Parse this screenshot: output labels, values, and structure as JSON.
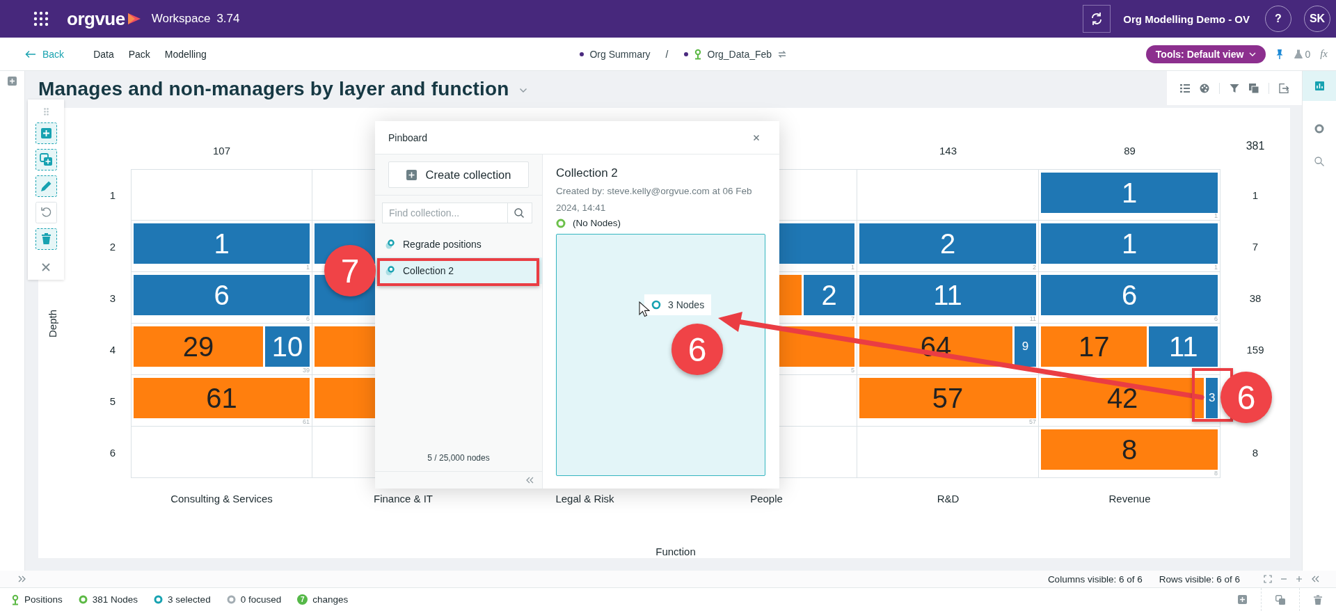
{
  "app_bar": {
    "logo": "orgvue",
    "product": "Workspace",
    "version": "3.74",
    "workspace_name": "Org Modelling Demo - OV",
    "help": "?",
    "user_initials": "SK"
  },
  "nav": {
    "back": "Back",
    "menu": [
      "Data",
      "Pack",
      "Modelling"
    ],
    "breadcrumb": [
      "Org Summary",
      "Org_Data_Feb"
    ],
    "separator": "/",
    "tools": "Tools: Default view",
    "flask_count": "0",
    "formula": "fx"
  },
  "chart": {
    "title": "Manages and non-managers by layer and function",
    "ylabel": "Depth",
    "xlabel": "Function",
    "grand_total": "381",
    "rows": [
      {
        "label": "1",
        "total": "1"
      },
      {
        "label": "2",
        "total": "7"
      },
      {
        "label": "3",
        "total": "38"
      },
      {
        "label": "4",
        "total": "159"
      },
      {
        "label": "5"
      },
      {
        "label": "6",
        "total": "8"
      }
    ],
    "columns": [
      {
        "label": "Consulting & Services",
        "total": "107",
        "cells": [
          {},
          {
            "segments": [
              {
                "color": "#1f77b4",
                "value": "1"
              }
            ],
            "count": "1"
          },
          {
            "segments": [
              {
                "color": "#1f77b4",
                "value": "6"
              }
            ],
            "count": "6"
          },
          {
            "segments": [
              {
                "color": "#ff7f0e",
                "value": "29"
              },
              {
                "color": "#1f77b4",
                "value": "10"
              }
            ],
            "count": "39"
          },
          {
            "segments": [
              {
                "color": "#ff7f0e",
                "value": "61"
              }
            ],
            "count": "61"
          },
          {}
        ]
      },
      {
        "label": "Finance & IT",
        "cells": [
          {},
          {
            "segments": [
              {
                "color": "#1f77b4"
              }
            ]
          },
          {
            "segments": [
              {
                "color": "#1f77b4"
              }
            ]
          },
          {
            "segments": [
              {
                "color": "#ff7f0e"
              }
            ]
          },
          {
            "segments": [
              {
                "color": "#ff7f0e"
              }
            ]
          },
          {}
        ]
      },
      {
        "label": "Legal & Risk"
      },
      {
        "label": "People",
        "cells": [
          {},
          {
            "segments": [
              {
                "color": "#1f77b4"
              }
            ],
            "count": "1"
          },
          {
            "segments": [
              {
                "color": "#ff7f0e"
              },
              {
                "color": "#1f77b4",
                "value": "2"
              }
            ],
            "count": "7"
          },
          {
            "segments": [
              {
                "color": "#ff7f0e"
              }
            ],
            "count": "5"
          },
          {},
          {}
        ]
      },
      {
        "label": "R&D",
        "total": "143",
        "cells": [
          {},
          {
            "segments": [
              {
                "color": "#1f77b4",
                "value": "2"
              }
            ],
            "count": "2"
          },
          {
            "segments": [
              {
                "color": "#1f77b4",
                "value": "11"
              }
            ],
            "count": "11"
          },
          {
            "segments": [
              {
                "color": "#ff7f0e",
                "value": "64"
              },
              {
                "color": "#1f77b4",
                "value": "9"
              }
            ]
          },
          {
            "segments": [
              {
                "color": "#ff7f0e",
                "value": "57"
              }
            ],
            "count": "57"
          },
          {}
        ]
      },
      {
        "label": "Revenue",
        "total": "89",
        "cells": [
          {
            "segments": [
              {
                "color": "#1f77b4",
                "value": "1"
              }
            ],
            "count": "1"
          },
          {
            "segments": [
              {
                "color": "#1f77b4",
                "value": "1"
              }
            ],
            "count": "1"
          },
          {
            "segments": [
              {
                "color": "#1f77b4",
                "value": "6"
              }
            ],
            "count": "6"
          },
          {
            "segments": [
              {
                "color": "#ff7f0e",
                "value": "17"
              },
              {
                "color": "#1f77b4",
                "value": "11"
              }
            ]
          },
          {
            "segments": [
              {
                "color": "#ff7f0e",
                "value": "42"
              },
              {
                "color": "#1f77b4",
                "value": "3"
              }
            ]
          },
          {
            "segments": [
              {
                "color": "#ff7f0e",
                "value": "8"
              }
            ],
            "count": "8"
          }
        ]
      }
    ]
  },
  "pinboard": {
    "title": "Pinboard",
    "create_button": "Create collection",
    "search": {
      "placeholder": "Find collection..."
    },
    "collections": [
      {
        "name": "Regrade positions",
        "selected": false
      },
      {
        "name": "Collection 2",
        "selected": true
      }
    ],
    "node_usage": "5 / 25,000 nodes",
    "detail": {
      "title": "Collection 2",
      "created_by": "Created by: steve.kelly@orgvue.com at 06 Feb 2024, 14:41",
      "status": "(No Nodes)"
    },
    "drag_chip": "3 Nodes"
  },
  "annotations": [
    {
      "kind": "highlight"
    },
    {
      "kind": "badge",
      "text": "7"
    },
    {
      "kind": "arrow"
    },
    {
      "kind": "badge",
      "text": "6"
    },
    {
      "kind": "highlight"
    },
    {
      "kind": "badge",
      "text": "6"
    }
  ],
  "footer": {
    "columns_visible": "Columns visible: 6 of 6",
    "rows_visible": "Rows visible: 6 of 6"
  },
  "status_bar": [
    {
      "kind": "positions",
      "text": "Positions"
    },
    {
      "kind": "ring",
      "color": "#5cb945",
      "text": "381 Nodes"
    },
    {
      "kind": "ring",
      "color": "#17a2b1",
      "text": "3 selected"
    },
    {
      "kind": "ring",
      "color": "#a3adb3",
      "text": "0 focused"
    },
    {
      "kind": "badge",
      "badge": "7",
      "text": "changes"
    }
  ]
}
